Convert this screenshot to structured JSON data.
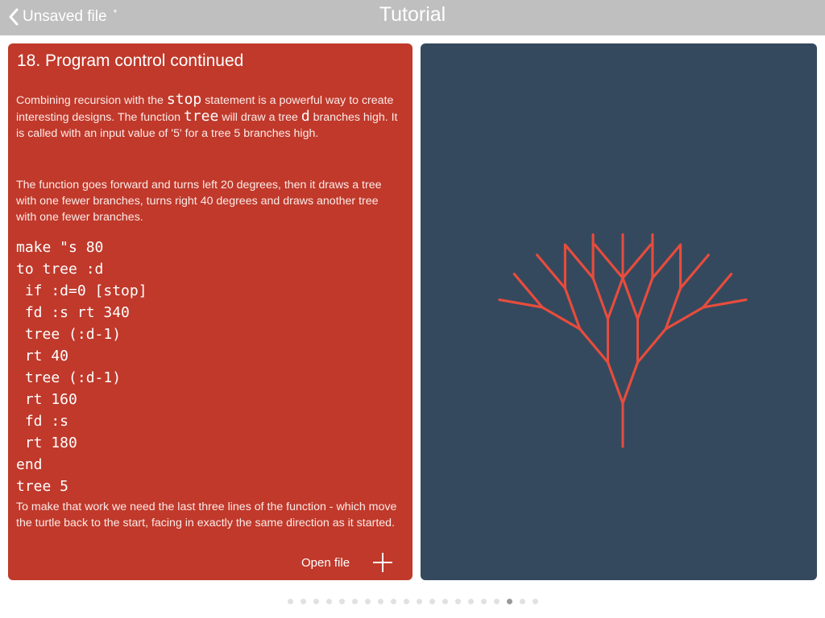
{
  "header": {
    "back_label": "Unsaved file",
    "unsaved_marker": "*",
    "title": "Tutorial"
  },
  "lesson": {
    "title": "18. Program control continued",
    "para1": {
      "t1": "Combining recursion with the ",
      "k1": "stop",
      "t2": " statement is a powerful way to create interesting designs. The function ",
      "k2": "tree",
      "t3": " will draw a tree ",
      "k3": "d",
      "t4": " branches high. It is called with an input value of '5' for a tree 5 branches high."
    },
    "para2": "The function goes forward and turns left 20 degrees, then it draws a tree with one fewer branches, turns right 40 degrees and draws another tree with one fewer branches.",
    "code_lines": [
      "make \"s 80",
      "to tree :d",
      " if :d=0 [stop]",
      " fd :s rt 340",
      " tree (:d-1)",
      " rt 40",
      " tree (:d-1)",
      " rt 160",
      " fd :s",
      " rt 180",
      "end",
      "tree 5"
    ],
    "para3": "To make that work we need the last three lines of the function - which move the turtle back to the start, facing in exactly the same direction as it started.",
    "open_file_label": "Open file"
  },
  "canvas": {
    "background": "#34495e",
    "line_color": "#e74c3c",
    "tree_depth": 5,
    "turn_left_degrees": 20,
    "turn_right_degrees": 40
  },
  "pager": {
    "total": 20,
    "current": 18
  },
  "colors": {
    "topbar": "#bfbfbf",
    "card": "#c0392b",
    "canvas": "#34495e",
    "tree": "#e74c3c"
  },
  "icons": {
    "back": "chevron-left-icon",
    "add": "plus-icon"
  }
}
